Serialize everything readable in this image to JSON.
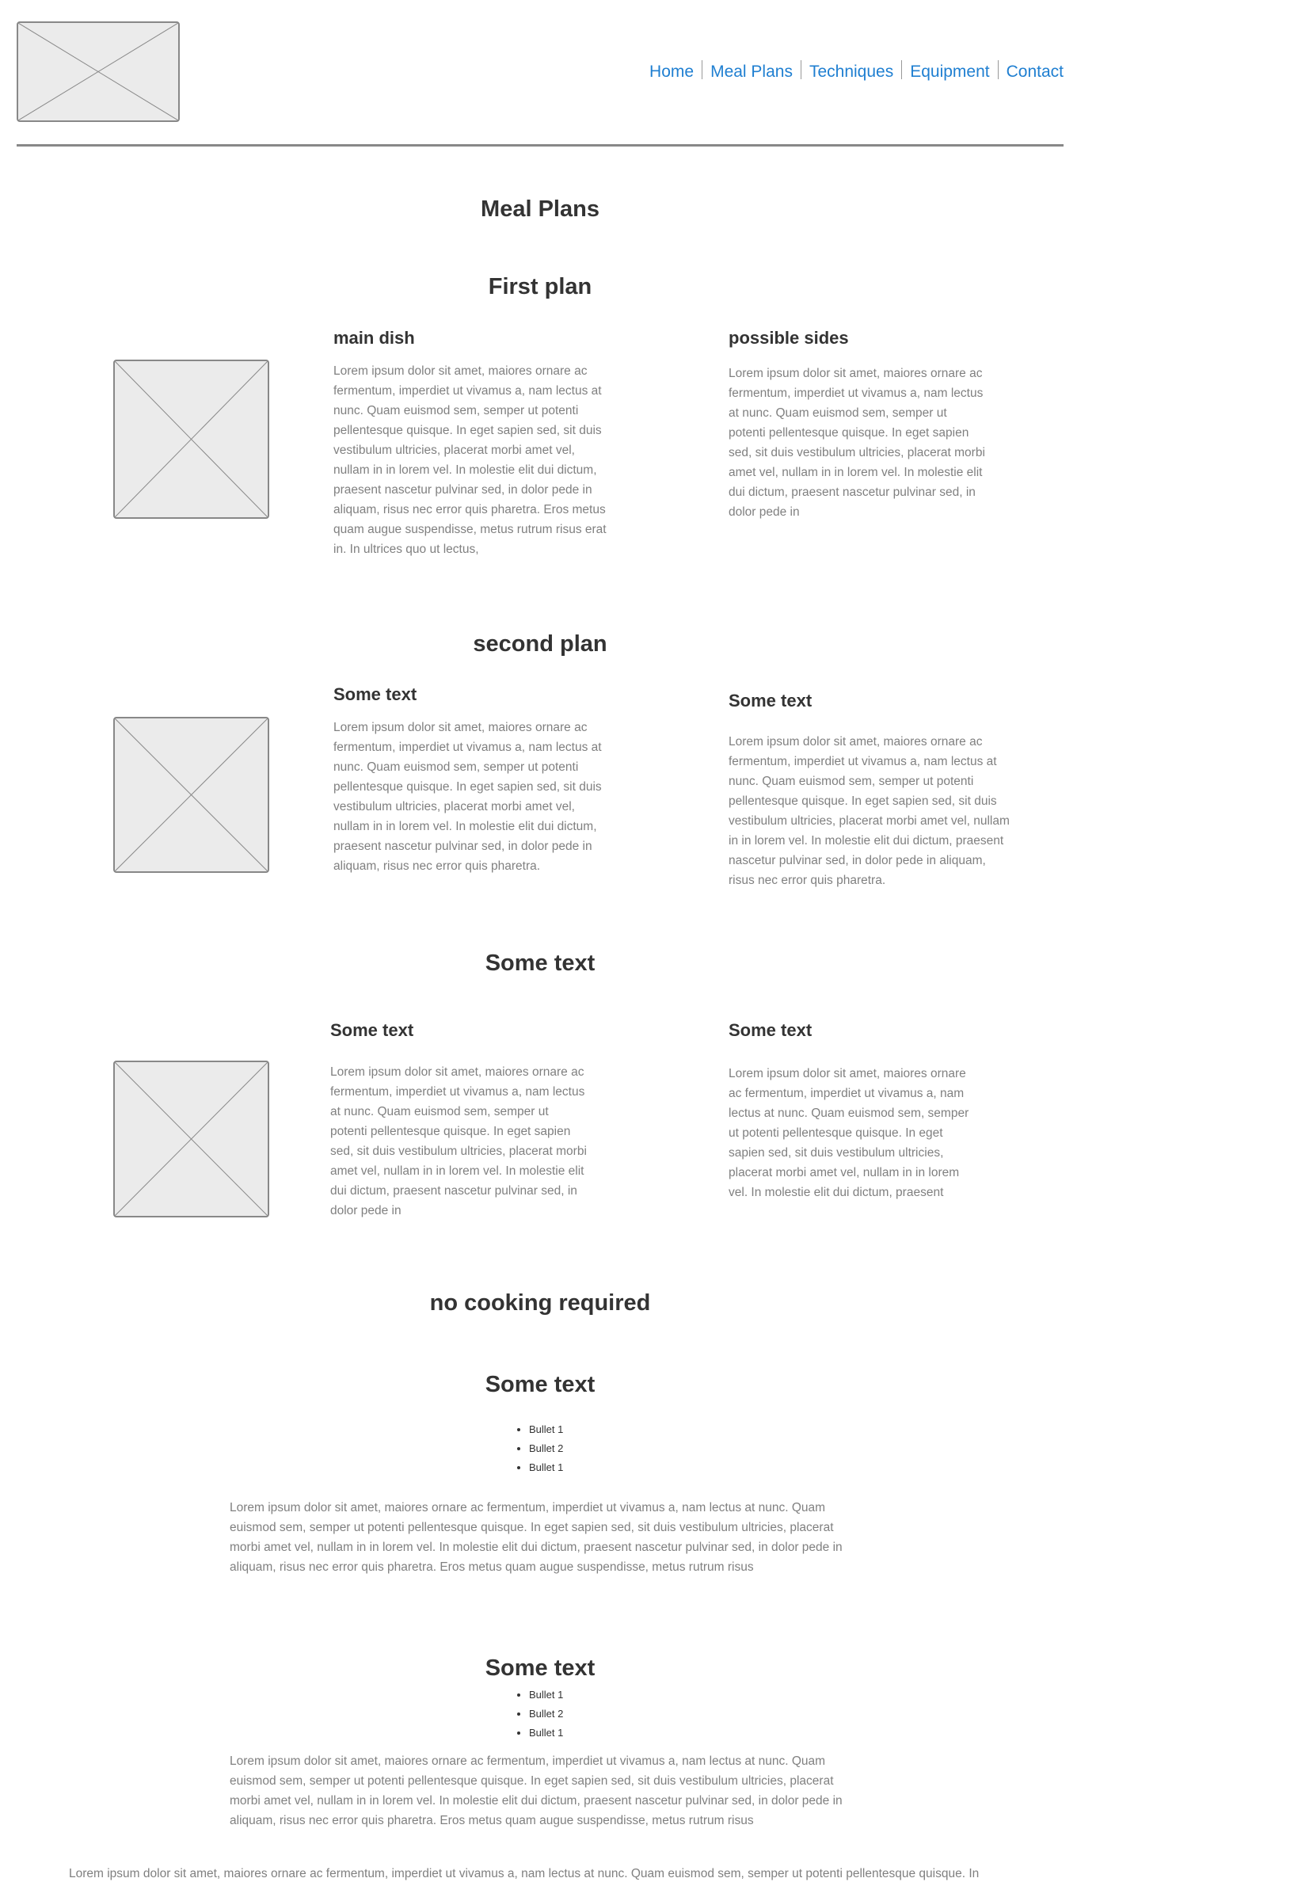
{
  "header": {
    "logo": "logo-placeholder",
    "nav": [
      {
        "label": "Home"
      },
      {
        "label": "Meal Plans"
      },
      {
        "label": "Techniques"
      },
      {
        "label": "Equipment"
      },
      {
        "label": "Contact"
      }
    ],
    "nav_color": "#1f7fd1"
  },
  "page_title": "Meal Plans",
  "sections": [
    {
      "title": "First plan",
      "left": {
        "heading": "main dish",
        "body": "Lorem ipsum dolor sit amet, maiores ornare ac fermentum, imperdiet ut vivamus a, nam lectus at nunc. Quam euismod sem, semper ut potenti pellentesque quisque. In eget sapien sed, sit duis vestibulum ultricies, placerat morbi amet vel, nullam in in lorem vel. In molestie elit dui dictum, praesent nascetur pulvinar sed, in dolor pede in aliquam, risus nec error quis pharetra. Eros metus quam augue suspendisse, metus rutrum risus erat in.  In ultrices quo ut lectus,"
      },
      "right": {
        "heading": "possible sides",
        "body": "Lorem ipsum dolor sit amet, maiores ornare ac fermentum, imperdiet ut vivamus a, nam lectus at nunc. Quam euismod sem, semper ut potenti pellentesque quisque. In eget sapien sed, sit duis vestibulum ultricies, placerat morbi amet vel, nullam in in lorem vel. In molestie elit dui dictum, praesent nascetur pulvinar sed, in dolor pede in"
      }
    },
    {
      "title": "second plan",
      "left": {
        "heading": "Some text",
        "body": "Lorem ipsum dolor sit amet, maiores ornare ac fermentum, imperdiet ut vivamus a, nam lectus at nunc. Quam euismod sem, semper ut potenti pellentesque quisque. In eget sapien sed, sit duis vestibulum ultricies, placerat morbi amet vel, nullam in in lorem vel. In molestie elit dui dictum, praesent nascetur pulvinar sed, in dolor pede in aliquam, risus nec error quis pharetra."
      },
      "right": {
        "heading": "Some text",
        "body": "Lorem ipsum dolor sit amet, maiores ornare ac fermentum, imperdiet ut vivamus a, nam lectus at nunc. Quam euismod sem, semper ut potenti pellentesque quisque. In eget sapien sed, sit duis vestibulum ultricies, placerat morbi amet vel, nullam in in lorem vel. In molestie elit dui dictum, praesent nascetur pulvinar sed, in dolor pede in aliquam, risus nec error quis pharetra."
      }
    },
    {
      "title": "Some text",
      "left": {
        "heading": "Some text",
        "body": "Lorem ipsum dolor sit amet, maiores ornare ac fermentum, imperdiet ut vivamus a, nam lectus at nunc. Quam euismod sem, semper ut potenti pellentesque quisque. In eget sapien sed, sit duis vestibulum ultricies, placerat morbi amet vel, nullam in in lorem vel. In molestie elit dui dictum, praesent nascetur pulvinar sed, in dolor pede in"
      },
      "right": {
        "heading": "Some text",
        "body": "Lorem ipsum dolor sit amet, maiores ornare ac fermentum, imperdiet ut vivamus a, nam lectus at nunc. Quam euismod sem, semper ut potenti pellentesque quisque. In eget sapien sed, sit duis vestibulum ultricies, placerat morbi amet vel, nullam in in lorem vel. In molestie elit dui dictum, praesent"
      }
    }
  ],
  "no_cooking": {
    "title": "no cooking required",
    "blocks": [
      {
        "heading": "Some text",
        "bullets": [
          "Bullet 1",
          "Bullet 2",
          "Bullet 1"
        ],
        "body": "Lorem ipsum dolor sit amet, maiores ornare ac fermentum, imperdiet ut vivamus a, nam lectus at nunc. Quam euismod sem, semper ut potenti pellentesque quisque. In eget sapien sed, sit duis vestibulum ultricies, placerat morbi amet vel, nullam in in lorem vel. In molestie elit dui dictum, praesent nascetur pulvinar sed, in dolor pede in aliquam, risus nec error quis pharetra. Eros metus quam augue suspendisse, metus rutrum risus"
      },
      {
        "heading": "Some text",
        "bullets": [
          "Bullet 1",
          "Bullet 2",
          "Bullet 1"
        ],
        "body": "Lorem ipsum dolor sit amet, maiores ornare ac fermentum, imperdiet ut vivamus a, nam lectus at nunc. Quam euismod sem, semper ut potenti pellentesque quisque. In eget sapien sed, sit duis vestibulum ultricies, placerat morbi amet vel, nullam in in lorem vel. In molestie elit dui dictum, praesent nascetur pulvinar sed, in dolor pede in aliquam, risus nec error quis pharetra. Eros metus quam augue suspendisse, metus rutrum risus"
      }
    ]
  },
  "footer_text": "Lorem ipsum dolor sit amet, maiores ornare ac fermentum, imperdiet ut vivamus a, nam lectus at nunc. Quam euismod sem, semper ut potenti pellentesque quisque. In"
}
